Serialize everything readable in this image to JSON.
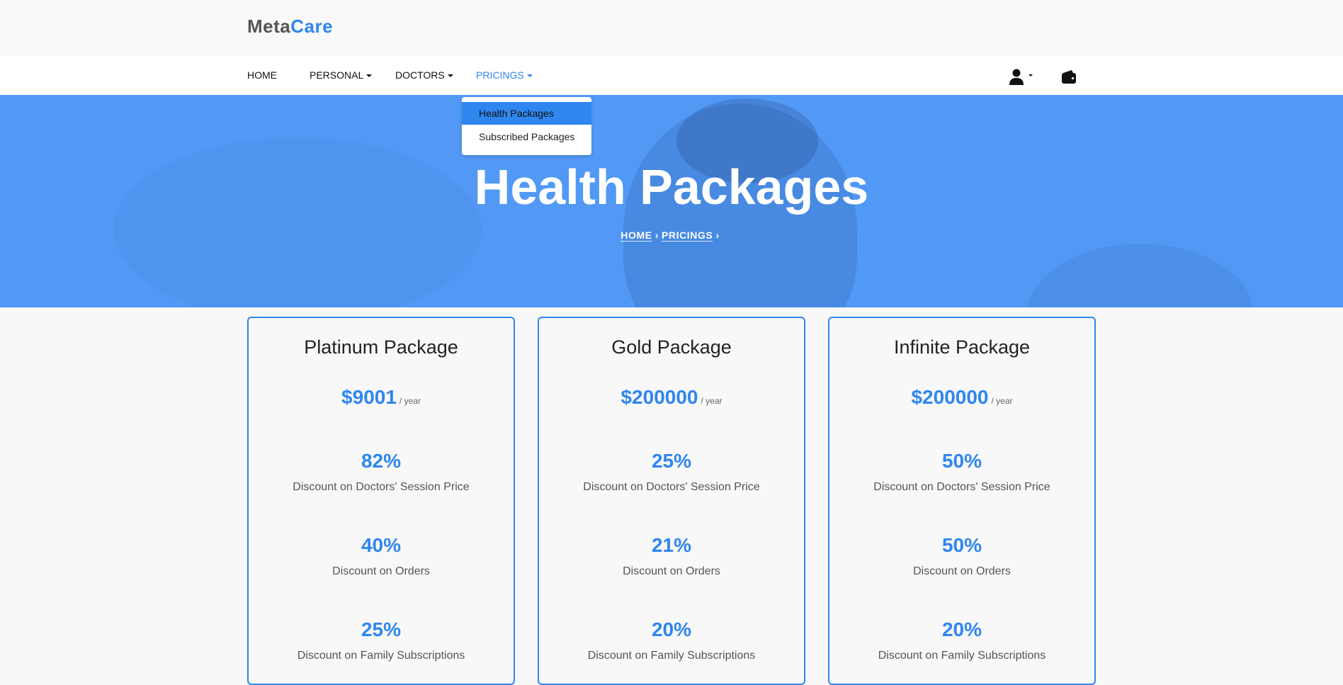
{
  "logo": {
    "part1": "Meta",
    "part2": "Care"
  },
  "nav": {
    "home": "HOME",
    "personal": "PERSONAL",
    "doctors": "DOCTORS",
    "pricings": "PRICINGS"
  },
  "icons": {
    "user": "user-icon",
    "wallet": "wallet-icon"
  },
  "dropdown": {
    "items": [
      "Health Packages",
      "Subscribed Packages"
    ]
  },
  "hero": {
    "title": "Health Packages",
    "breadcrumb": [
      "HOME",
      "PRICINGS"
    ]
  },
  "colors": {
    "accent": "#2f86ef",
    "hero_bg": "#5299f5"
  },
  "packages": [
    {
      "name": "Platinum Package",
      "price": "$9001",
      "period": "/ year",
      "features": [
        {
          "value": "82%",
          "label": "Discount on Doctors' Session Price"
        },
        {
          "value": "40%",
          "label": "Discount on Orders"
        },
        {
          "value": "25%",
          "label": "Discount on Family Subscriptions"
        }
      ]
    },
    {
      "name": "Gold Package",
      "price": "$200000",
      "period": "/ year",
      "features": [
        {
          "value": "25%",
          "label": "Discount on Doctors' Session Price"
        },
        {
          "value": "21%",
          "label": "Discount on Orders"
        },
        {
          "value": "20%",
          "label": "Discount on Family Subscriptions"
        }
      ]
    },
    {
      "name": "Infinite Package",
      "price": "$200000",
      "period": "/ year",
      "features": [
        {
          "value": "50%",
          "label": "Discount on Doctors' Session Price"
        },
        {
          "value": "50%",
          "label": "Discount on Orders"
        },
        {
          "value": "20%",
          "label": "Discount on Family Subscriptions"
        }
      ]
    }
  ]
}
